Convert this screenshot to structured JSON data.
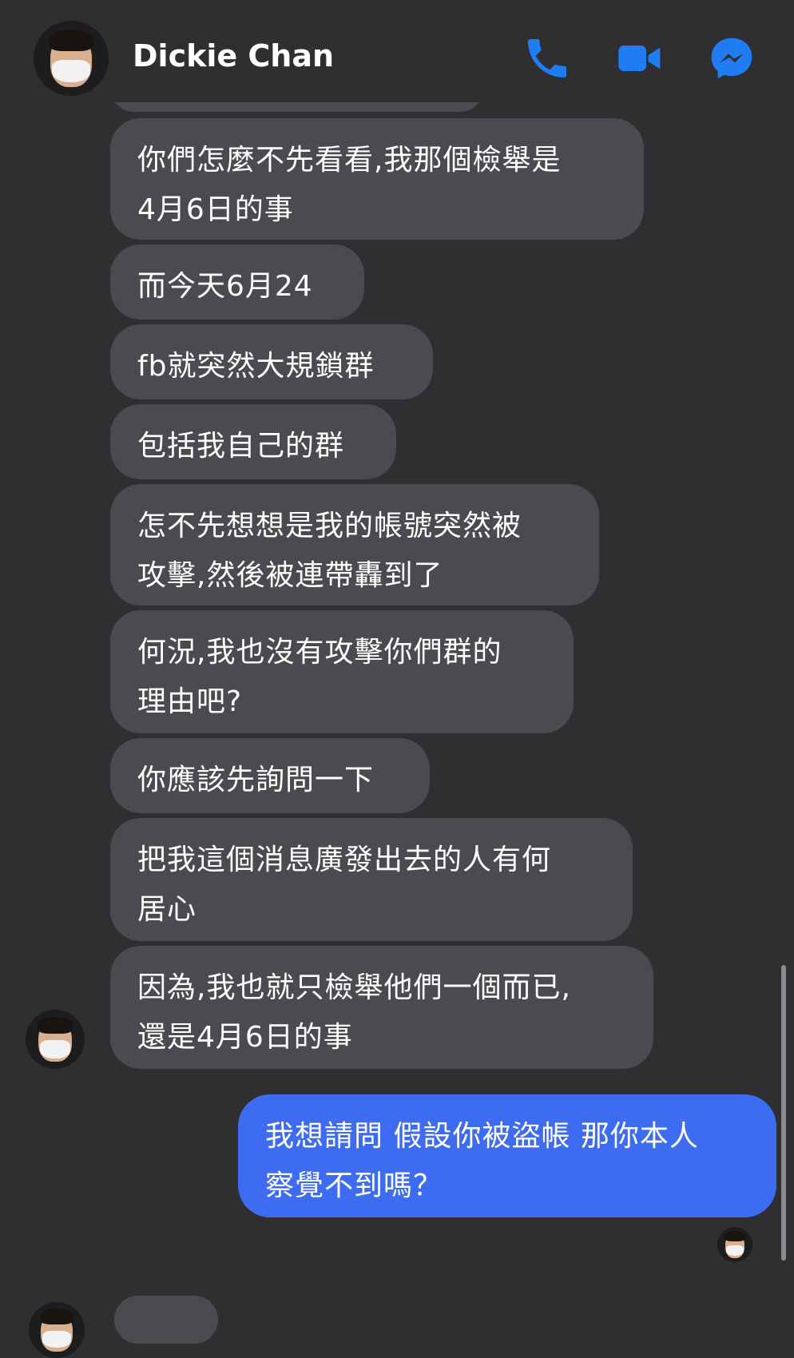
{
  "header": {
    "contact_name": "Dickie Chan",
    "icons": [
      "phone-icon",
      "video-camera-icon",
      "messenger-icon"
    ],
    "accent_color": "#1f7cf2"
  },
  "messages": [
    {
      "from": "contact",
      "text": "你們怎麼不先看看,我那個檢舉是\n4月6日的事"
    },
    {
      "from": "contact",
      "text": "而今天6月24"
    },
    {
      "from": "contact",
      "text": "fb就突然大規鎖群"
    },
    {
      "from": "contact",
      "text": "包括我自己的群"
    },
    {
      "from": "contact",
      "text": "怎不先想想是我的帳號突然被\n攻擊,然後被連帶轟到了"
    },
    {
      "from": "contact",
      "text": "何況,我也沒有攻擊你們群的\n理由吧?"
    },
    {
      "from": "contact",
      "text": "你應該先詢問一下"
    },
    {
      "from": "contact",
      "text": "把我這個消息廣發出去的人有何\n居心"
    },
    {
      "from": "contact",
      "text": "因為,我也就只檢舉他們一個而已,\n還是4月6日的事"
    },
    {
      "from": "me",
      "text": "我想請問 假設你被盜帳 那你本人\n察覺不到嗎？"
    }
  ],
  "colors": {
    "background": "#2f2f32",
    "incoming_bubble": "#4a4a4f",
    "outgoing_bubble": "#3d6cf0"
  }
}
